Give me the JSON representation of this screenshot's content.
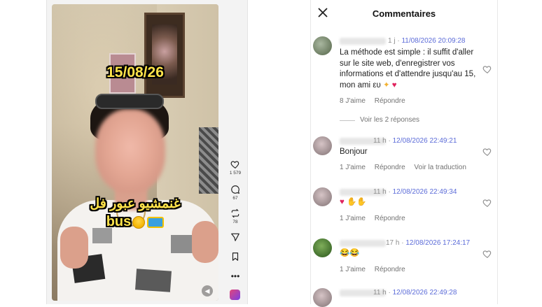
{
  "video": {
    "date_overlay": "15/08/26",
    "caption_arabic": "غنمشيو عبور فل",
    "caption_word": "bus",
    "sound_icon": "speaker-icon",
    "actions": {
      "likes": "1 579",
      "comments": "67",
      "reposts": "78"
    }
  },
  "comments_panel": {
    "title": "Commentaires",
    "close_icon": "close-icon",
    "view_replies": "Voir les 2 réponses",
    "comments": [
      {
        "age": "1 j",
        "date": "11/08/2026 20:09:28",
        "text": "La méthode est simple : il suffit d'aller sur le site web, d'enregistrer vos informations et d'attendre jusqu'au 15, mon ami",
        "text_suffix": "ευ",
        "likes": "8 J'aime",
        "reply": "Répondre"
      },
      {
        "age": "11 h",
        "date": "12/08/2026 22:49:21",
        "text": "Bonjour",
        "likes": "1 J'aime",
        "reply": "Répondre",
        "translate": "Voir la traduction"
      },
      {
        "age": "11 h",
        "date": "12/08/2026 22:49:34",
        "text": "",
        "likes": "1 J'aime",
        "reply": "Répondre"
      },
      {
        "age": "17 h",
        "date": "12/08/2026 17:24:17",
        "text": "",
        "likes": "1 J'aime",
        "reply": "Répondre"
      },
      {
        "age": "11 h",
        "date": "12/08/2026 22:49:28"
      }
    ]
  }
}
